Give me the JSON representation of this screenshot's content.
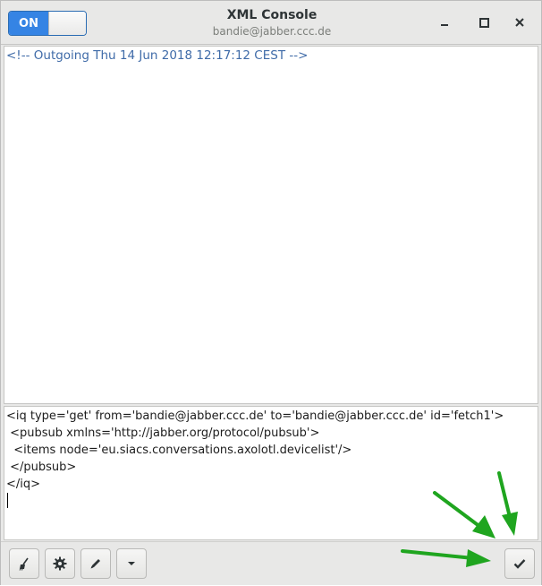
{
  "header": {
    "toggle_label": "ON",
    "title": "XML Console",
    "subtitle": "bandie@jabber.ccc.de"
  },
  "log": {
    "lines": [
      "<!-- Outgoing Thu 14 Jun 2018 12:17:12 CEST -->"
    ]
  },
  "editor": {
    "lines": [
      "<iq type='get' from='bandie@jabber.ccc.de' to='bandie@jabber.ccc.de' id='fetch1'>",
      " <pubsub xmlns='http://jabber.org/protocol/pubsub'>",
      "  <items node='eu.siacs.conversations.axolotl.devicelist'/>",
      " </pubsub>",
      "</iq>"
    ]
  },
  "toolbar": {
    "icons": [
      "broom-icon",
      "gear-icon",
      "pencil-icon",
      "chevron-down-icon",
      "checkmark-icon"
    ]
  },
  "colors": {
    "accent": "#3584e4",
    "log_text": "#3f6ba8",
    "annotation_arrow": "#1fa51f"
  }
}
